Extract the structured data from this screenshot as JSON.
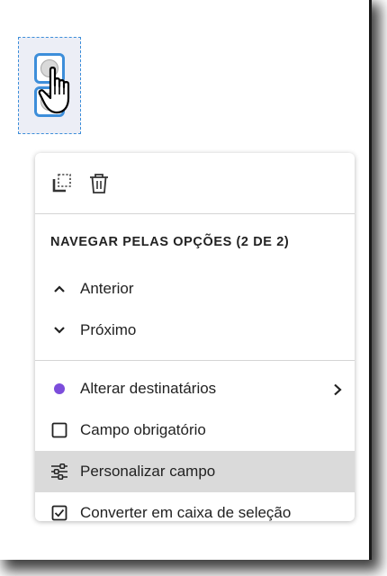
{
  "colors": {
    "selection_border": "#3d8eda",
    "recipient_dot": "#7c4ddb",
    "highlight_bg": "#dadada"
  },
  "field": {
    "type": "radio-group",
    "options_count": 2
  },
  "menu": {
    "toolbar": {
      "icons": [
        "duplicate-icon",
        "trash-icon"
      ]
    },
    "section_title": "NAVEGAR PELAS OPÇÕES (2 DE 2)",
    "nav_items": [
      {
        "icon": "chevron-up-icon",
        "label": "Anterior"
      },
      {
        "icon": "chevron-down-icon",
        "label": "Próximo"
      }
    ],
    "actions": [
      {
        "icon": "purple-dot-icon",
        "label": "Alterar destinatários",
        "has_submenu": true
      },
      {
        "icon": "checkbox-empty-icon",
        "label": "Campo obrigatório",
        "checked": false
      },
      {
        "icon": "sliders-icon",
        "label": "Personalizar campo",
        "highlighted": true
      },
      {
        "icon": "checkbox-checked-icon",
        "label": "Converter em caixa de seleção",
        "checked": true
      }
    ]
  }
}
